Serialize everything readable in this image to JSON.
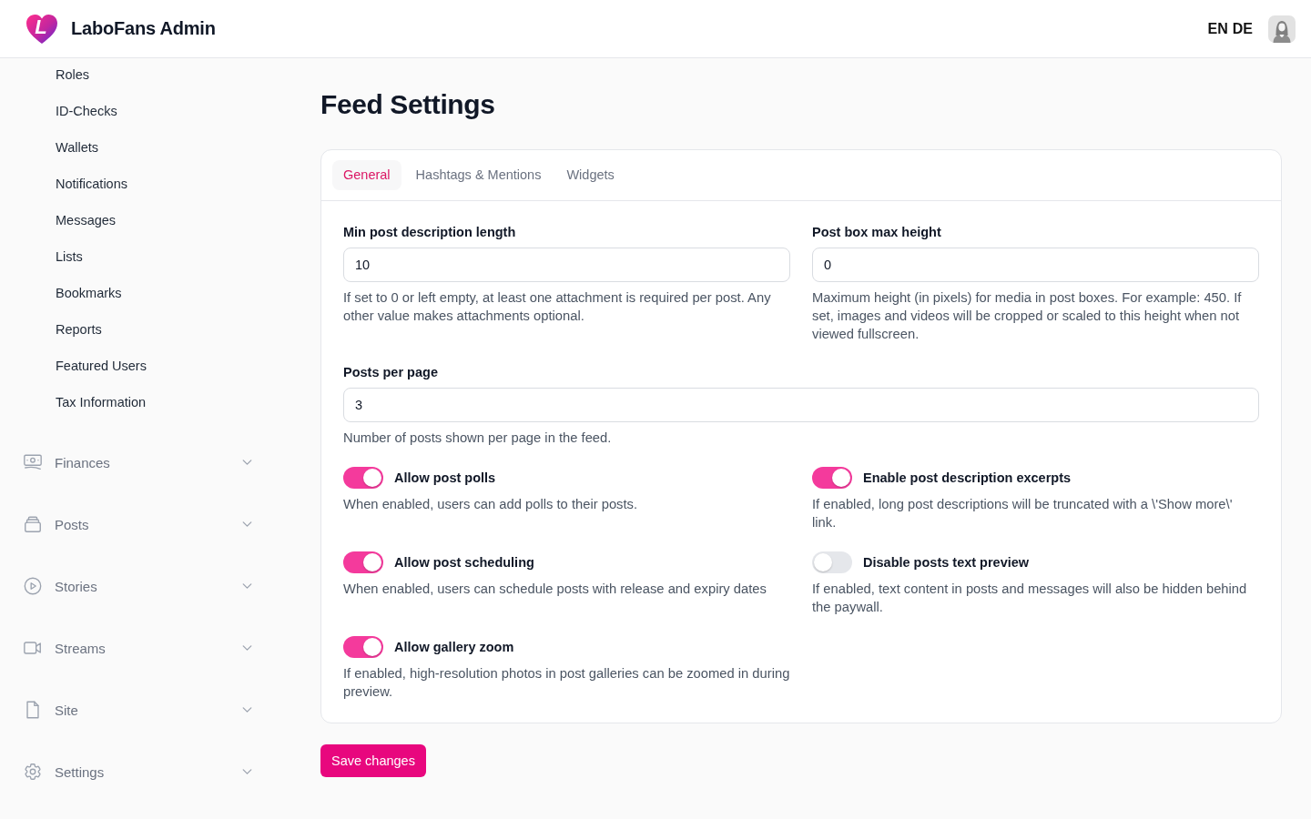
{
  "header": {
    "logo_letter": "L",
    "brand": "LaboFans Admin",
    "languages": [
      "EN",
      "DE"
    ]
  },
  "sidebar": {
    "items": [
      "Roles",
      "ID-Checks",
      "Wallets",
      "Notifications",
      "Messages",
      "Lists",
      "Bookmarks",
      "Reports",
      "Featured Users",
      "Tax Information"
    ],
    "groups": [
      {
        "label": "Finances",
        "expanded": false
      },
      {
        "label": "Posts",
        "expanded": false
      },
      {
        "label": "Stories",
        "expanded": false
      },
      {
        "label": "Streams",
        "expanded": false
      },
      {
        "label": "Site",
        "expanded": false
      },
      {
        "label": "Settings",
        "expanded": false
      }
    ]
  },
  "page": {
    "title": "Feed Settings",
    "tabs": [
      {
        "label": "General",
        "selected": true
      },
      {
        "label": "Hashtags & Mentions",
        "selected": false
      },
      {
        "label": "Widgets",
        "selected": false
      }
    ],
    "field_rows": [
      [
        {
          "label": "Min post description length",
          "value": "10",
          "help": "If set to 0 or left empty, at least one attachment is required per post. Any other value makes attachments optional."
        },
        {
          "label": "Post box max height",
          "value": "0",
          "help": "Maximum height (in pixels) for media in post boxes. For example: 450. If set, images and videos will be cropped or scaled to this height when not viewed fullscreen."
        }
      ],
      [
        {
          "label": "Posts per page",
          "value": "3",
          "help": "Number of posts shown per page in the feed."
        }
      ]
    ],
    "toggles": [
      {
        "label": "Allow post polls",
        "on": true,
        "help": "When enabled, users can add polls to their posts."
      },
      {
        "label": "Enable post description excerpts",
        "on": true,
        "help": "If enabled, long post descriptions will be truncated with a \\'Show more\\' link."
      },
      {
        "label": "Allow post scheduling",
        "on": true,
        "help": "When enabled, users can schedule posts with release and expiry dates"
      },
      {
        "label": "Disable posts text preview",
        "on": false,
        "help": "If enabled, text content in posts and messages will also be hidden behind the paywall."
      },
      {
        "label": "Allow gallery zoom",
        "on": true,
        "help": "If enabled, high-resolution photos in post galleries can be zoomed in during preview."
      }
    ],
    "save_button": "Save changes"
  }
}
